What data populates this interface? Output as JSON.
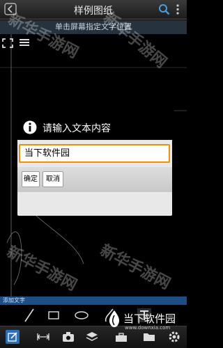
{
  "header": {
    "title": "样例图纸"
  },
  "hint": {
    "text": "单击屏幕指定文字位置"
  },
  "dialog": {
    "title": "请输入文本内容",
    "input_value": "当下软件园",
    "ok_label": "确定",
    "cancel_label": "取消"
  },
  "label_bar": {
    "text": "添加文字"
  },
  "watermark": {
    "text": "新华手游网"
  },
  "brand": {
    "name": "当下软件园",
    "url": "www.downxia.com"
  },
  "colors": {
    "accent": "#e79013",
    "active_tool": "#2d6fb6",
    "label_bar": "#1d4f86"
  }
}
